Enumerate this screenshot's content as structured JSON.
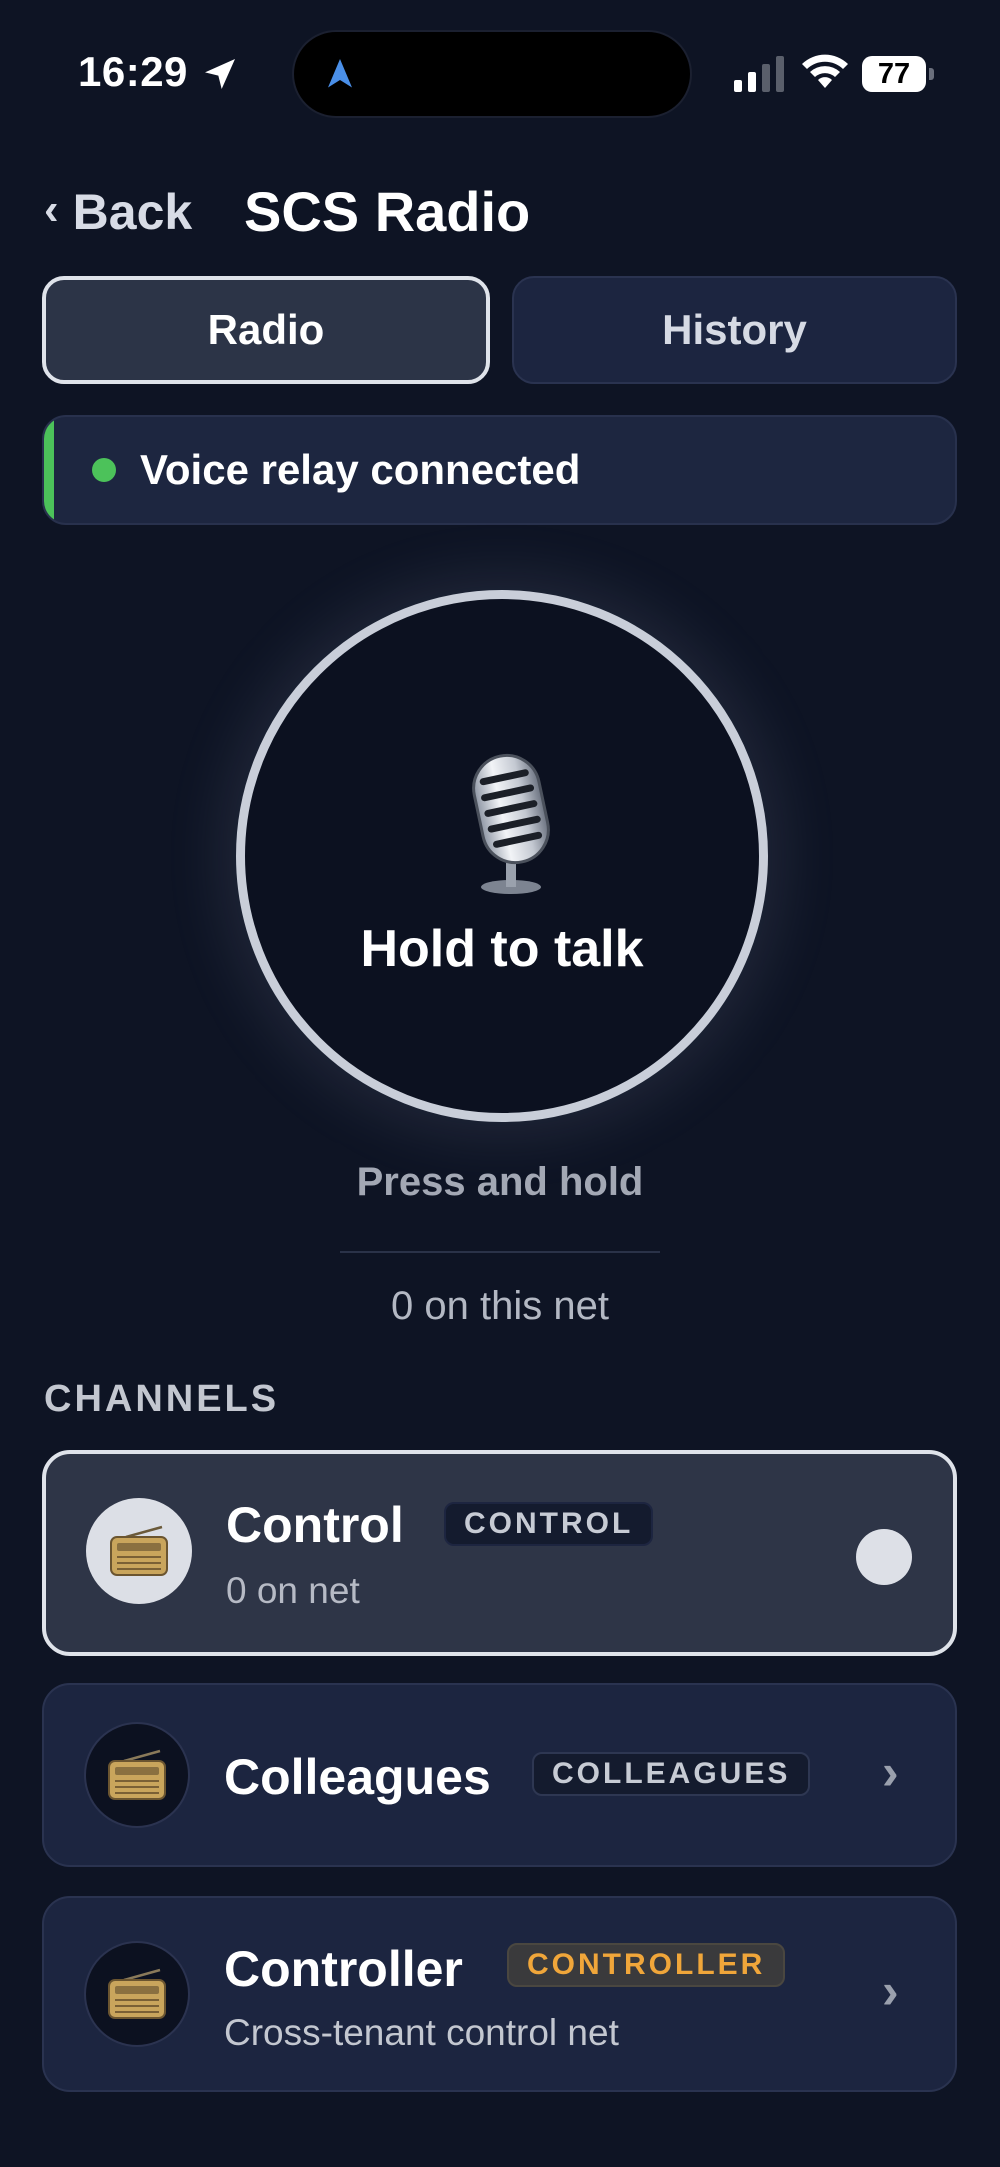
{
  "status_bar": {
    "time": "16:29",
    "battery": "77",
    "icons": [
      "location-arrow-icon",
      "navigation-icon",
      "signal-icon",
      "wifi-icon",
      "battery-icon"
    ]
  },
  "header": {
    "back_label": "Back",
    "back_icon": "chevron-left-icon",
    "title": "SCS Radio"
  },
  "tabs": [
    {
      "label": "Radio",
      "selected": true
    },
    {
      "label": "History",
      "selected": false
    }
  ],
  "banner": {
    "text": "Voice relay connected",
    "status_color": "#4cc25a"
  },
  "talk": {
    "icon": "microphone-icon",
    "label": "Hold to talk",
    "hint": "Press and hold",
    "net_count": "0 on this net"
  },
  "channels_section": {
    "label": "CHANNELS",
    "items": [
      {
        "name": "Control",
        "badge": "CONTROL",
        "subtitle": "0 on net",
        "icon": "radio-icon",
        "selected": true
      },
      {
        "name": "Colleagues",
        "badge": "COLLEAGUES",
        "subtitle": "",
        "icon": "radio-icon",
        "selected": false
      },
      {
        "name": "Controller",
        "badge": "CONTROLLER",
        "subtitle": "Cross-tenant control net",
        "icon": "radio-icon",
        "selected": false,
        "badge_color": "#f0a63a"
      }
    ]
  },
  "colors": {
    "background": "#0e1424",
    "card": "#1c2540",
    "accent_green": "#4cc25a",
    "accent_orange": "#f0a63a"
  }
}
